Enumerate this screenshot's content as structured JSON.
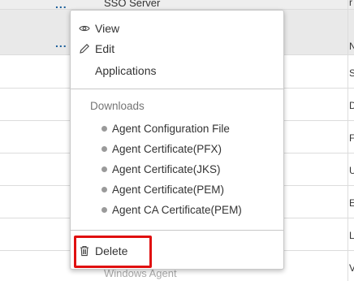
{
  "background_table": {
    "rows": [
      {
        "text": "SSO Server",
        "right": "r"
      },
      {
        "text": "",
        "right": "N"
      },
      {
        "text": "",
        "right": "S"
      },
      {
        "text": "",
        "right": "D"
      },
      {
        "text": "",
        "right": "F"
      },
      {
        "text": "",
        "right": "U"
      },
      {
        "text": "",
        "right": "E"
      },
      {
        "text": "",
        "right": "L"
      },
      {
        "text": "Windows Agent",
        "right": "V"
      }
    ],
    "actions_glyph": "..."
  },
  "menu": {
    "view_label": "View",
    "edit_label": "Edit",
    "applications_label": "Applications",
    "downloads_section_label": "Downloads",
    "downloads": [
      "Agent Configuration File",
      "Agent Certificate(PFX)",
      "Agent Certificate(JKS)",
      "Agent Certificate(PEM)",
      "Agent CA Certificate(PEM)"
    ],
    "delete_label": "Delete"
  },
  "colors": {
    "highlight": "#e01010",
    "dots": "#1a5e9a"
  },
  "icons": {
    "view": "eye-icon",
    "edit": "pencil-icon",
    "delete": "trash-icon"
  }
}
